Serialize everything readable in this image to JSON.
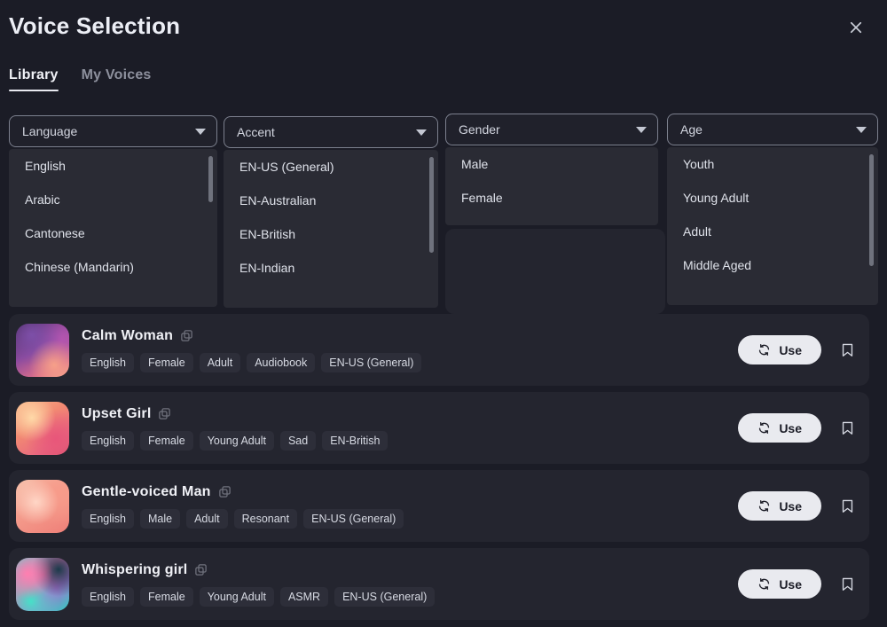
{
  "header": {
    "title": "Voice Selection",
    "close_icon": "close-icon"
  },
  "tabs": [
    {
      "label": "Library",
      "active": true
    },
    {
      "label": "My Voices",
      "active": false
    }
  ],
  "filters": [
    {
      "id": "language",
      "label": "Language",
      "caret_icon": "chevron-down-icon",
      "options": [
        "English",
        "Arabic",
        "Cantonese",
        "Chinese (Mandarin)"
      ]
    },
    {
      "id": "accent",
      "label": "Accent",
      "caret_icon": "chevron-down-icon",
      "options": [
        "EN-US (General)",
        "EN-Australian",
        "EN-British",
        "EN-Indian"
      ]
    },
    {
      "id": "gender",
      "label": "Gender",
      "caret_icon": "chevron-down-icon",
      "options": [
        "Male",
        "Female"
      ]
    },
    {
      "id": "age",
      "label": "Age",
      "caret_icon": "chevron-down-icon",
      "options": [
        "Youth",
        "Young Adult",
        "Adult",
        "Middle Aged"
      ]
    }
  ],
  "voices": [
    {
      "name": "Calm Woman",
      "copy_icon": "copy-icon",
      "tags": [
        "English",
        "Female",
        "Adult",
        "Audiobook",
        "EN-US (General)"
      ],
      "use_label": "Use",
      "use_icon": "refresh-icon",
      "bookmark_icon": "bookmark-icon"
    },
    {
      "name": "Upset Girl",
      "copy_icon": "copy-icon",
      "tags": [
        "English",
        "Female",
        "Young Adult",
        "Sad",
        "EN-British"
      ],
      "use_label": "Use",
      "use_icon": "refresh-icon",
      "bookmark_icon": "bookmark-icon"
    },
    {
      "name": "Gentle-voiced Man",
      "copy_icon": "copy-icon",
      "tags": [
        "English",
        "Male",
        "Adult",
        "Resonant",
        "EN-US (General)"
      ],
      "use_label": "Use",
      "use_icon": "refresh-icon",
      "bookmark_icon": "bookmark-icon"
    },
    {
      "name": "Whispering girl",
      "copy_icon": "copy-icon",
      "tags": [
        "English",
        "Female",
        "Young Adult",
        "ASMR",
        "EN-US (General)"
      ],
      "use_label": "Use",
      "use_icon": "refresh-icon",
      "bookmark_icon": "bookmark-icon"
    }
  ],
  "colors": {
    "page_background": "#1b1c26",
    "card_background": "#24252f",
    "dropdown_background": "#2a2b34",
    "tag_background": "#2d2e39",
    "text_primary": "#f0f1f6",
    "text_secondary": "#8d909d",
    "use_button_background": "#e9eaef",
    "select_border": "#7c808e"
  }
}
